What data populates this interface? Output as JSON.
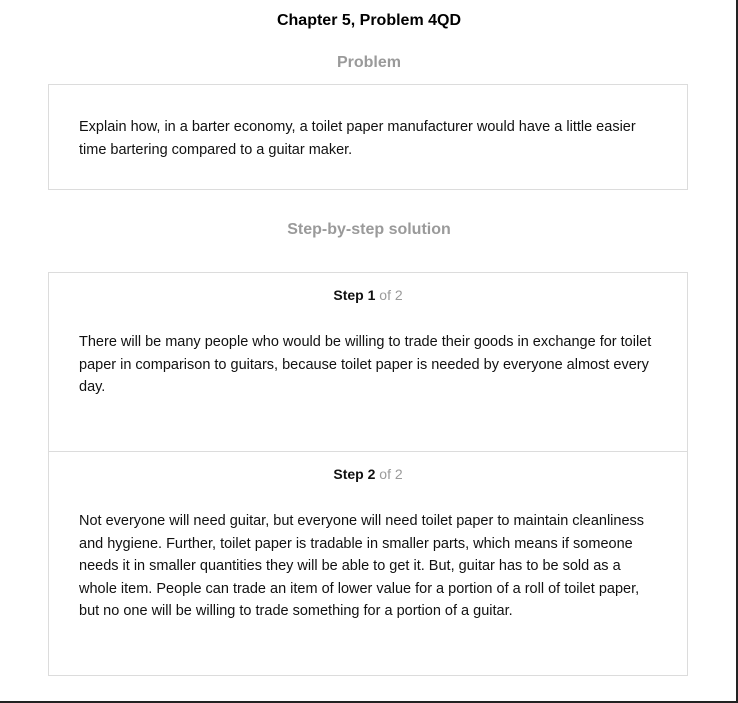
{
  "title": "Chapter 5, Problem 4QD",
  "problem": {
    "heading": "Problem",
    "text": "Explain how, in a barter economy, a toilet paper manufacturer would have a little easier time bartering compared to a guitar maker."
  },
  "solution": {
    "heading": "Step-by-step solution",
    "steps": [
      {
        "label": "Step",
        "number": "1",
        "of_text": "of 2",
        "text": "There will be many people who would be willing to trade their goods in exchange for toilet paper in comparison to guitars, because toilet paper is needed by everyone almost every day."
      },
      {
        "label": "Step",
        "number": "2",
        "of_text": "of 2",
        "text": "Not everyone will need guitar, but everyone will need toilet paper to maintain cleanliness and hygiene. Further, toilet paper is tradable in smaller parts, which means if someone needs it in smaller quantities they will be able to get it. But, guitar has to be sold as a whole item. People can trade an item of lower value for a portion of a roll of toilet paper, but no one will be willing to trade something for a portion of a guitar."
      }
    ]
  }
}
